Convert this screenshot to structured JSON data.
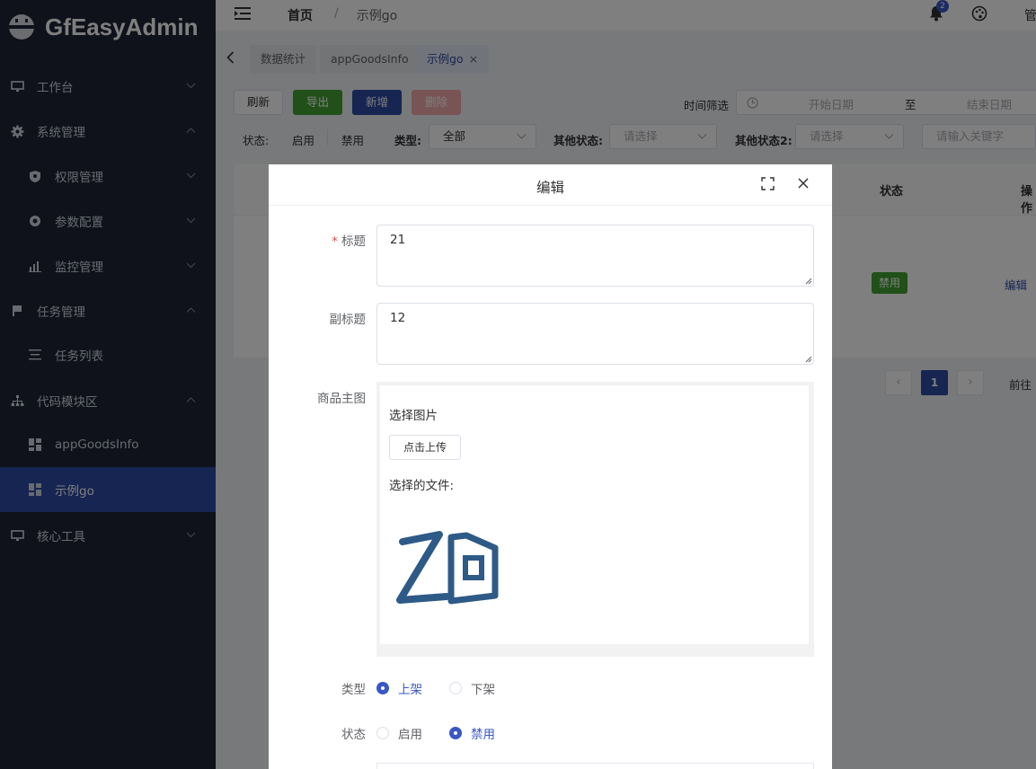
{
  "app": {
    "name": "GfEasyAdmin"
  },
  "sidebar": {
    "items": [
      {
        "label": "工作台",
        "icon": "monitor-icon"
      },
      {
        "label": "系统管理",
        "icon": "gear-icon"
      },
      {
        "label": "权限管理",
        "icon": "shield-icon"
      },
      {
        "label": "参数配置",
        "icon": "settings-dot-icon"
      },
      {
        "label": "监控管理",
        "icon": "bar-chart-icon"
      },
      {
        "label": "任务管理",
        "icon": "flag-icon"
      },
      {
        "label": "任务列表",
        "icon": "list-icon"
      },
      {
        "label": "代码模块区",
        "icon": "tree-icon"
      },
      {
        "label": "appGoodsInfo",
        "icon": "grid-icon"
      },
      {
        "label": "示例go",
        "icon": "grid-icon"
      },
      {
        "label": "核心工具",
        "icon": "monitor-icon"
      }
    ]
  },
  "header": {
    "breadcrumb_home": "首页",
    "breadcrumb_sep": "/",
    "breadcrumb_current": "示例go",
    "notification_count": "2",
    "user_label": "管"
  },
  "tags": [
    {
      "label": "数据统计"
    },
    {
      "label": "appGoodsInfo"
    },
    {
      "label": "示例go",
      "close": "×"
    }
  ],
  "toolbar": {
    "refresh": "刷新",
    "export": "导出",
    "add": "新增",
    "delete": "删除",
    "time_filter_label": "时间筛选",
    "start_date": "开始日期",
    "to": "至",
    "end_date": "结束日期"
  },
  "filters": {
    "status_label": "状态:",
    "status_on": "启用",
    "status_off": "禁用",
    "type_label": "类型:",
    "type_value": "全部",
    "other_status_label": "其他状态:",
    "other_status_placeholder": "请选择",
    "other_status2_label": "其他状态2:",
    "other_status2_placeholder": "请选择",
    "keyword_placeholder": "请输入关键字"
  },
  "table": {
    "col_status": "状态",
    "col_action": "操作",
    "row_status": "禁用",
    "row_action": "编辑"
  },
  "pager": {
    "current": "1",
    "goto": "前往"
  },
  "dialog": {
    "title": "编辑",
    "title_label": "标题",
    "title_value": "21",
    "subtitle_label": "副标题",
    "subtitle_value": "12",
    "image_label": "商品主图",
    "choose_image": "选择图片",
    "upload_button": "点击上传",
    "selected_files": "选择的文件:",
    "type_label": "类型",
    "type_on": "上架",
    "type_off": "下架",
    "status_label": "状态",
    "status_on": "启用",
    "status_off": "禁用"
  },
  "colors": {
    "sidebar_bg": "#1f2536",
    "primary": "#2c4ba5",
    "success": "#43a132",
    "danger_light": "#f2a8a8"
  }
}
